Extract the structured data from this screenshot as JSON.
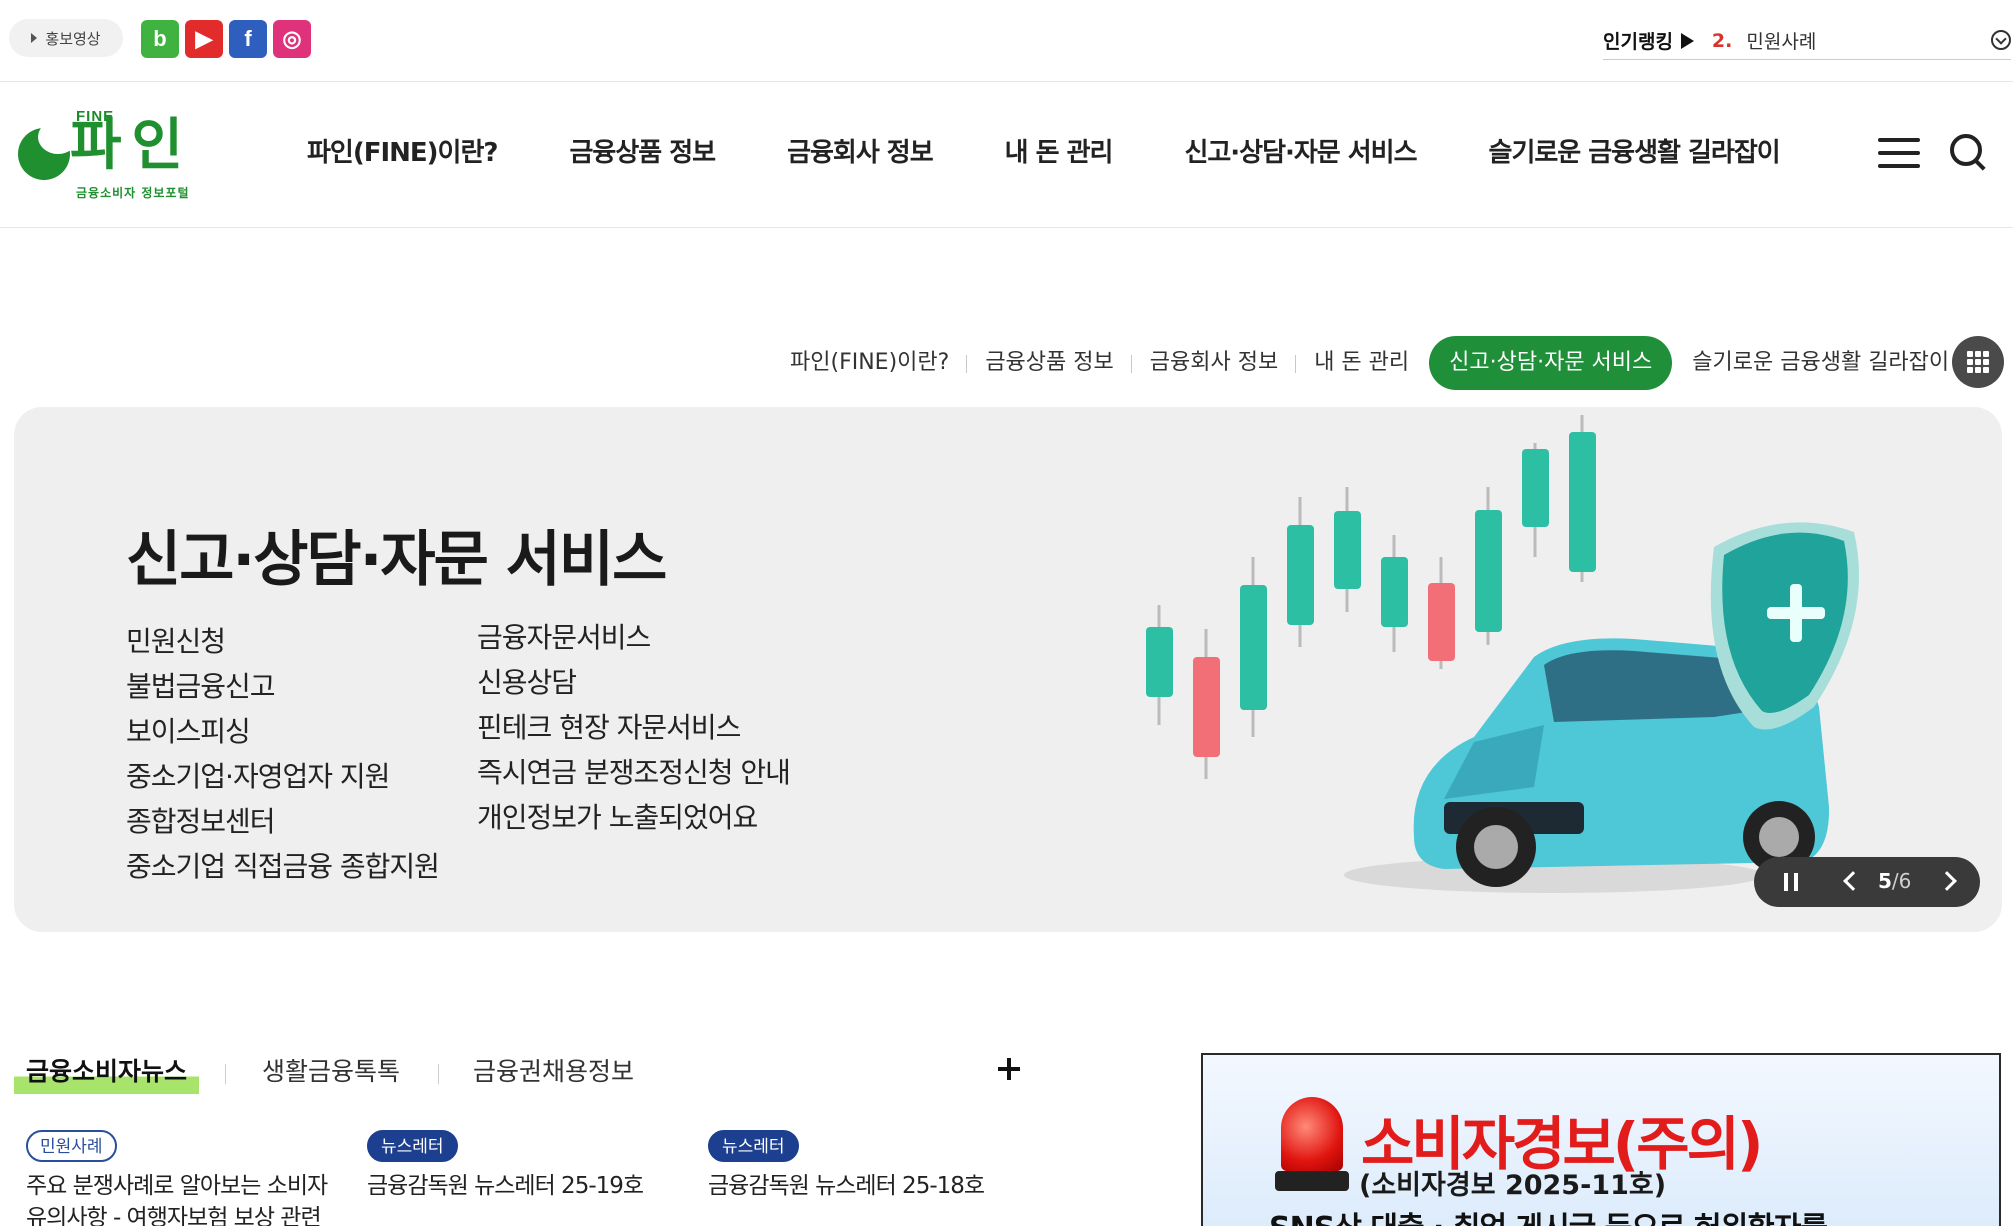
{
  "topbar": {
    "promo_label": "홍보영상",
    "social": [
      {
        "name": "blog",
        "glyph": "b",
        "color": "#3fb23f"
      },
      {
        "name": "youtube",
        "glyph": "▶",
        "color": "#e22b2b"
      },
      {
        "name": "facebook",
        "glyph": "f",
        "color": "#2e5fbf"
      },
      {
        "name": "instagram",
        "glyph": "◎",
        "color": "#e0327a"
      }
    ],
    "ranking": {
      "label": "인기랭킹",
      "number": "2.",
      "text": "민원사례"
    }
  },
  "header": {
    "logo": {
      "fine": "FINE",
      "word": "파인",
      "sub": "금융소비자 정보포털"
    },
    "nav": [
      "파인(FINE)이란?",
      "금융상품 정보",
      "금융회사 정보",
      "내 돈 관리",
      "신고·상담·자문 서비스",
      "슬기로운 금융생활 길라잡이"
    ]
  },
  "subnav": {
    "items": [
      "파인(FINE)이란?",
      "금융상품 정보",
      "금융회사 정보",
      "내 돈 관리",
      "신고·상담·자문 서비스",
      "슬기로운 금융생활 길라잡이"
    ],
    "active_index": 4
  },
  "hero": {
    "title": "신고·상담·자문 서비스",
    "col1": [
      "민원신청",
      "불법금융신고",
      "보이스피싱",
      "중소기업·자영업자 지원",
      "종합정보센터",
      "중소기업 직접금융 종합지원"
    ],
    "col2": [
      "금융자문서비스",
      "신용상담",
      "핀테크 현장 자문서비스",
      "즉시연금 분쟁조정신청 안내",
      "개인정보가 노출되었어요"
    ],
    "slider": {
      "current": "5",
      "separator": "/",
      "total": "6"
    }
  },
  "news": {
    "tabs": [
      "금융소비자뉴스",
      "생활금융톡톡",
      "금융권채용정보"
    ],
    "active_tab": 0,
    "items": [
      {
        "badge": "민원사례",
        "badge_style": "outline",
        "title": "주요 분쟁사례로 알아보는 소비자 유의사항 - 여행자보험 보상 관련"
      },
      {
        "badge": "뉴스레터",
        "badge_style": "filled",
        "title": "금융감독원 뉴스레터 25-19호"
      },
      {
        "badge": "뉴스레터",
        "badge_style": "filled",
        "title": "금융감독원 뉴스레터 25-18호"
      }
    ]
  },
  "alert_banner": {
    "title": "소비자경보(주의)",
    "subtitle": "(소비자경보 2025-11호)",
    "line": "SNS상 대출 · 취업 게시글 등으로 허위환자를"
  },
  "colors": {
    "brand_green": "#1f8f3a",
    "ranking_red": "#d6332c",
    "badge_navy": "#1d3f8f",
    "alert_red": "#e21b1b"
  }
}
